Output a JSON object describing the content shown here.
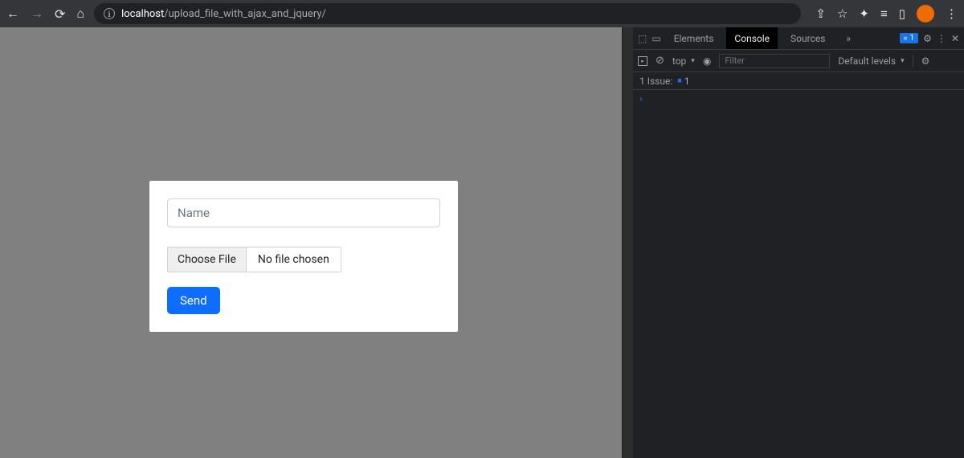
{
  "browser": {
    "url_host": "localhost",
    "url_path": "/upload_file_with_ajax_and_jquery/"
  },
  "form": {
    "name_placeholder": "Name",
    "choose_file_label": "Choose File",
    "file_status": "No file chosen",
    "submit_label": "Send"
  },
  "devtools": {
    "tabs": {
      "elements": "Elements",
      "console": "Console",
      "sources": "Sources",
      "overflow": "»"
    },
    "badge_count": "1",
    "context": "top",
    "filter_placeholder": "Filter",
    "levels": "Default levels",
    "issues_label": "1 Issue:",
    "issues_count": "1",
    "prompt": "›"
  }
}
